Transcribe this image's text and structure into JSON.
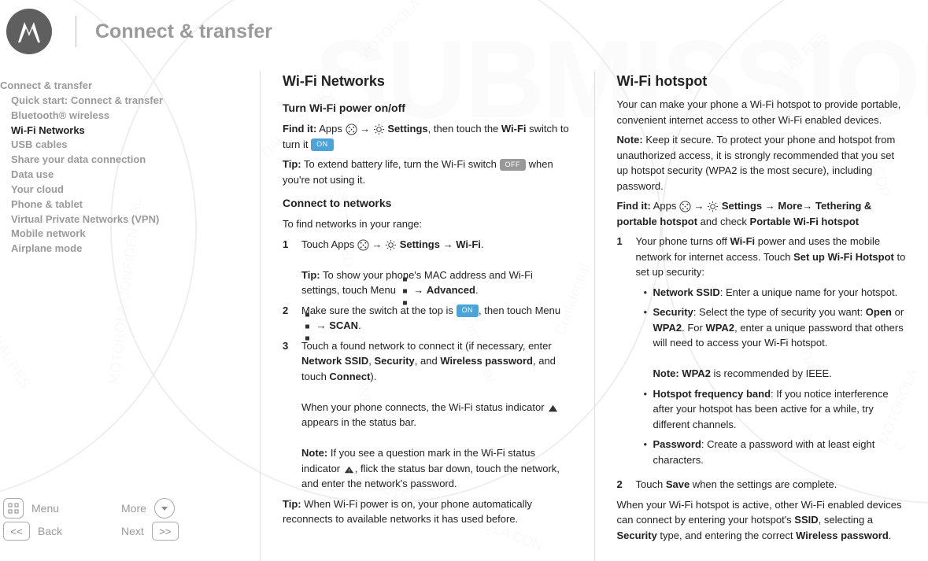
{
  "header": {
    "title": "Connect & transfer"
  },
  "toc": {
    "heading": "Connect & transfer",
    "items": [
      "Quick start: Connect & transfer",
      "Bluetooth® wireless",
      "Wi-Fi Networks",
      "USB cables",
      "Share your data connection",
      "Data use",
      "Your cloud",
      "Phone & tablet",
      "Virtual Private Networks (VPN)",
      "Mobile network",
      "Airplane mode"
    ],
    "active_index": 2
  },
  "nav": {
    "menu": "Menu",
    "more": "More",
    "back": "Back",
    "next": "Next"
  },
  "left": {
    "h2": "Wi-Fi Networks",
    "h3a": "Turn Wi-Fi power on/off",
    "findit_label": "Find it:",
    "findit_a": "Apps",
    "findit_b": "Settings",
    "findit_c": ", then touch the ",
    "findit_d": "Wi-Fi",
    "findit_e": " switch to turn it ",
    "tip1_label": "Tip:",
    "tip1": " To extend battery life, turn the Wi-Fi switch ",
    "tip1b": " when you're not using it.",
    "h3b": "Connect to networks",
    "intro": "To find networks in your range:",
    "s1a": "Touch Apps ",
    "s1b": " Settings",
    "s1c": " Wi-Fi",
    "s1tip_label": "Tip:",
    "s1tip": " To show your phone's MAC address and Wi-Fi settings, touch Menu ",
    "s1tip_b": " Advanced",
    "s2a": "Make sure the switch at the top is ",
    "s2b": ", then touch Menu ",
    "s2c": " SCAN",
    "s3a": "Touch a found network to connect it (if necessary, enter ",
    "s3b": "Network SSID",
    "s3c": "Security",
    "s3d": "Wireless password",
    "s3e": ", and touch ",
    "s3f": "Connect",
    "s3g": "When your phone connects, the Wi-Fi status indicator ",
    "s3h": " appears in the status bar.",
    "note_label": "Note:",
    "note": " If you see a question mark in the Wi-Fi status indicator ",
    "note_b": ", flick the status bar down, touch the network, and enter the network's password.",
    "tip2_label": "Tip:",
    "tip2": " When Wi-Fi power is on, your phone automatically reconnects to available networks it has used before.",
    "on": "ON",
    "off": "OFF"
  },
  "right": {
    "h2": "Wi-Fi hotspot",
    "p1": "Your can make your phone a Wi-Fi hotspot to provide portable, convenient internet access to other Wi-Fi enabled devices.",
    "note_label": "Note:",
    "note": " Keep it secure. To protect your phone and hotspot from unauthorized access, it is strongly recommended that you set up hotspot security (WPA2 is the most secure), including password.",
    "findit_label": "Find it:",
    "findit_a": " Apps ",
    "findit_b": " Settings ",
    "findit_c": " More",
    "findit_d": " Tethering & portable hotspot",
    "findit_e": " and check ",
    "findit_f": "Portable Wi-Fi hotspot",
    "s1a": "Your phone turns off ",
    "s1b": "Wi-Fi",
    "s1c": " power and uses the mobile network for internet access. Touch ",
    "s1d": "Set up Wi-Fi Hotspot",
    "s1e": " to set up security:",
    "b1a": "Network SSID",
    "b1b": ": Enter a unique name for your hotspot.",
    "b2a": "Security",
    "b2b": ": Select the type of security you want: ",
    "b2c": "Open",
    "b2d": " or ",
    "b2e": "WPA2",
    "b2f": ". For ",
    "b2g": "WPA2",
    "b2h": ", enter a unique password that others will need to access your Wi-Fi hotspot.",
    "b2note_label": "Note: WPA2",
    "b2note": " is recommended by IEEE.",
    "b3a": "Hotspot frequency band",
    "b3b": ": If you notice interference after your hotspot has been active for a while, try different channels.",
    "b4a": "Password",
    "b4b": ": Create a password with at least eight characters.",
    "s2a": "Touch ",
    "s2b": "Save",
    "s2c": " when the settings are complete.",
    "p_end_a": "When your Wi-Fi hotspot is active, other Wi-Fi enabled devices can connect by entering your hotspot's ",
    "p_end_b": "SSID",
    "p_end_c": ", selecting a ",
    "p_end_d": "Security",
    "p_end_e": " type, and entering the correct ",
    "p_end_f": "Wireless password"
  }
}
